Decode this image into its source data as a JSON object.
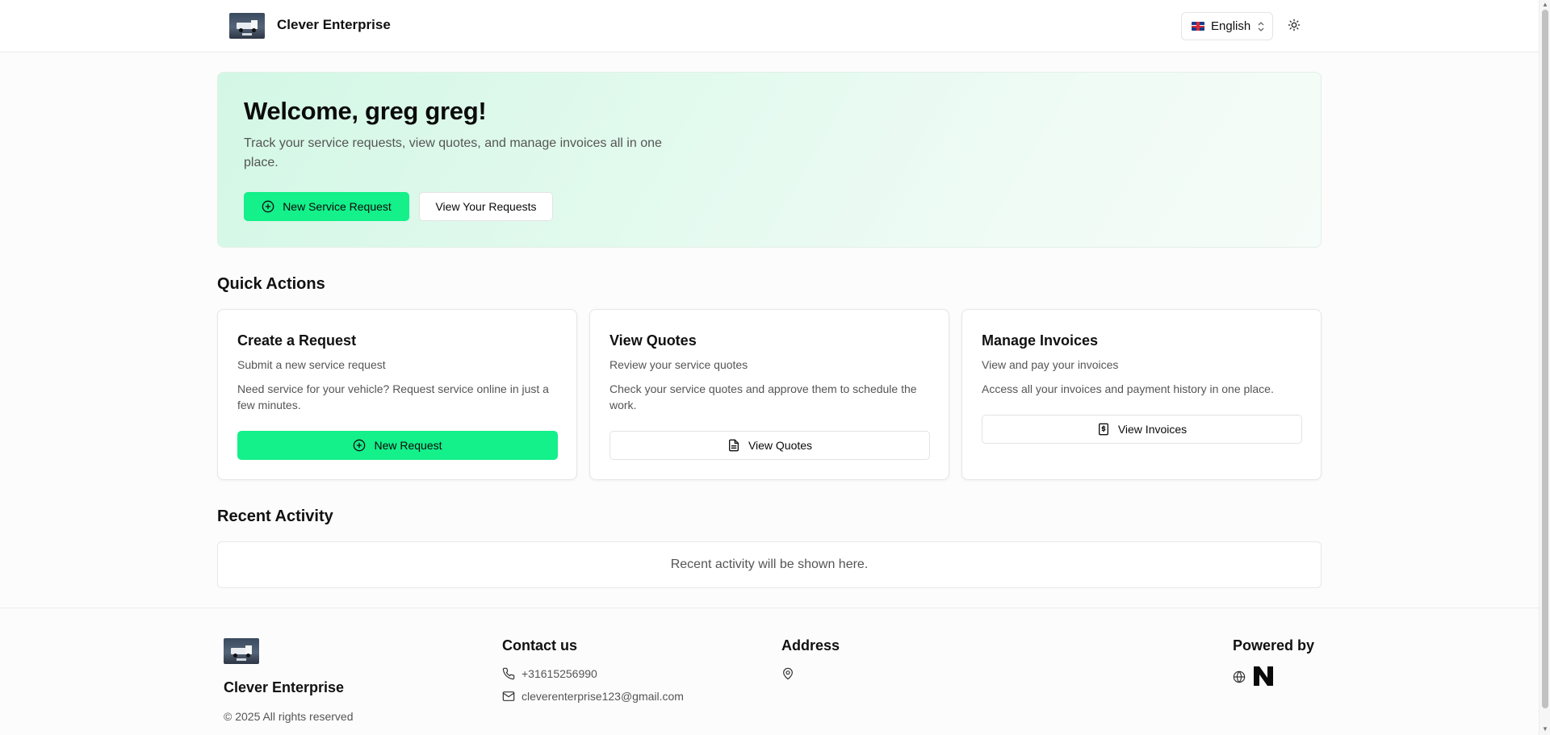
{
  "header": {
    "brand": "Clever Enterprise",
    "language": "English",
    "icons": {
      "language_flag": "uk-flag-icon",
      "language_chevron": "chevron-up-down-icon",
      "theme": "sun-icon"
    }
  },
  "hero": {
    "title": "Welcome, greg greg!",
    "subtitle": "Track your service requests, view quotes, and manage invoices all in one place.",
    "primary_button": "New Service Request",
    "secondary_button": "View Your Requests"
  },
  "quick_actions": {
    "title": "Quick Actions",
    "cards": [
      {
        "title": "Create a Request",
        "subtitle": "Submit a new service request",
        "description": "Need service for your vehicle? Request service online in just a few minutes.",
        "button": "New Request",
        "icon": "plus-circle-icon"
      },
      {
        "title": "View Quotes",
        "subtitle": "Review your service quotes",
        "description": "Check your service quotes and approve them to schedule the work.",
        "button": "View Quotes",
        "icon": "document-icon"
      },
      {
        "title": "Manage Invoices",
        "subtitle": "View and pay your invoices",
        "description": "Access all your invoices and payment history in one place.",
        "button": "View Invoices",
        "icon": "invoice-dollar-icon"
      }
    ]
  },
  "recent_activity": {
    "title": "Recent Activity",
    "empty_text": "Recent activity will be shown here."
  },
  "footer": {
    "brand": "Clever Enterprise",
    "copyright": "© 2025 All rights reserved",
    "contact": {
      "title": "Contact us",
      "phone": "+31615256990",
      "email": "cleverenterprise123@gmail.com"
    },
    "address": {
      "title": "Address"
    },
    "powered_by": {
      "title": "Powered by"
    }
  },
  "colors": {
    "accent": "#14f08a",
    "hero_background": "#d9f8e8",
    "text_primary": "#111111",
    "text_muted": "#555555"
  }
}
